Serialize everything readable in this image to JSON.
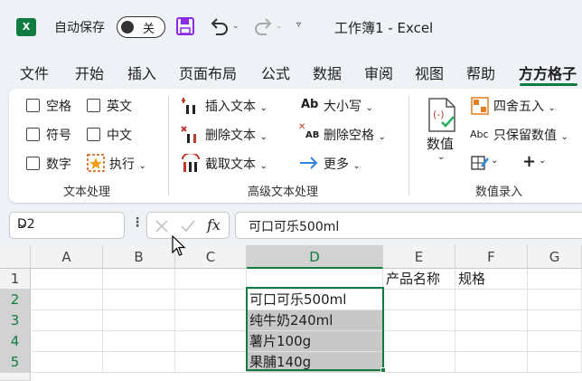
{
  "app": {
    "logo_text": "X",
    "autosave_label": "自动保存",
    "autosave_state": "关",
    "doc_title": "工作簿1 - Excel",
    "accent_color": "#107c41"
  },
  "tabs": [
    {
      "label": "文件"
    },
    {
      "label": "开始"
    },
    {
      "label": "插入"
    },
    {
      "label": "页面布局"
    },
    {
      "label": "公式"
    },
    {
      "label": "数据"
    },
    {
      "label": "审阅"
    },
    {
      "label": "视图"
    },
    {
      "label": "帮助"
    },
    {
      "label": "方方格子",
      "active": true
    }
  ],
  "ribbon": {
    "text_group": {
      "label": "文本处理",
      "checkboxes": [
        "空格",
        "英文",
        "符号",
        "中文",
        "数字"
      ],
      "exec": "执行"
    },
    "advanced_group": {
      "label": "高级文本处理",
      "insert": "插入文本",
      "delete": "删除文本",
      "extract": "截取文本",
      "case": "大小写",
      "case_icon_text": "Ab",
      "remove_space": "删除空格",
      "remove_space_icon_text": "AB",
      "more": "更多"
    },
    "number_group": {
      "label": "数值录入",
      "number": "数值",
      "round": "四舍五入",
      "keep": "只保留数值",
      "keep_icon_text": "Abc"
    }
  },
  "formula_bar": {
    "name_box": "D2",
    "fx_label": "fx",
    "formula": "可口可乐500ml"
  },
  "grid": {
    "columns": [
      "A",
      "B",
      "C",
      "D",
      "E",
      "F",
      "G"
    ],
    "rows": [
      "1",
      "2",
      "3",
      "4",
      "5"
    ],
    "e1": "产品名称",
    "f1": "规格",
    "d_values": [
      "可口可乐500ml",
      "纯牛奶240ml",
      "薯片100g",
      "果脯140g"
    ]
  }
}
